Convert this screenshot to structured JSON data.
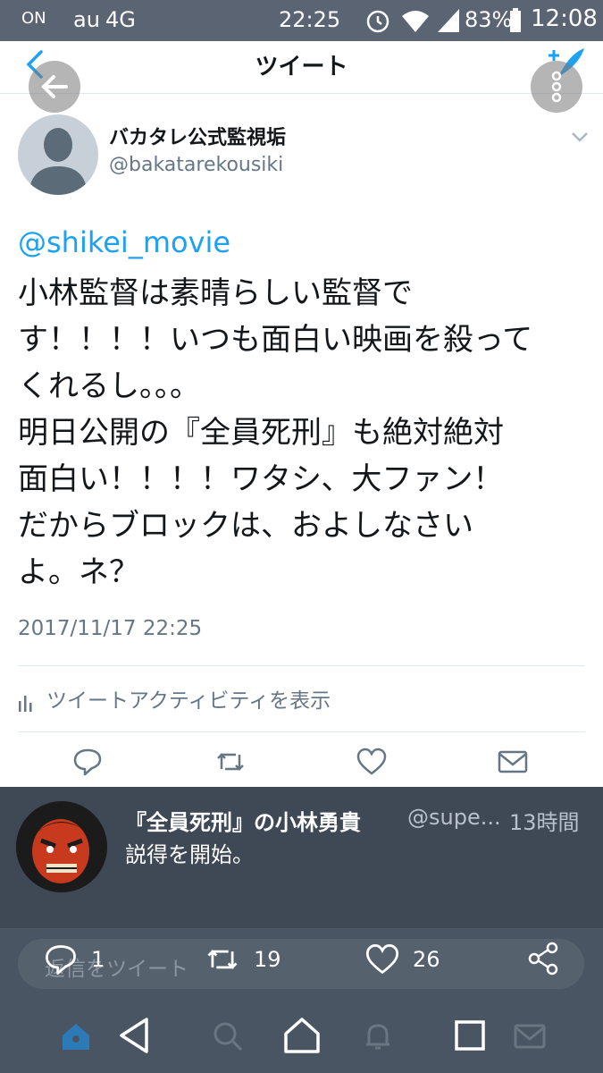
{
  "status_bar": {
    "carrier": "au",
    "network": "4G",
    "time_left": "22:25",
    "battery": "83%",
    "time_right": "12:08",
    "nfc": "ON"
  },
  "header": {
    "title": "ツイート"
  },
  "tweet": {
    "display_name": "バカタレ公式監視垢",
    "handle": "@bakatarekousiki",
    "mention": "@shikei_movie",
    "lines": [
      "小林監督は素晴らしい監督で",
      "す！！！！いつも面白い映画を殺って",
      "くれるし。。。",
      "明日公開の『全員死刑』も絶対絶対",
      "面白い！！！！ワタシ、大ファン！",
      "だからブロックは、およしなさい",
      "よ。ネ？"
    ],
    "timestamp": "2017/11/17 22:25",
    "activity_label": "ツイートアクティビティを表示"
  },
  "notification": {
    "name": "『全員死刑』の小林勇貴",
    "handle": "@supe...",
    "time": "13時間",
    "text": "説得を開始。"
  },
  "reply": {
    "placeholder": "返信をツイート",
    "reply_count": "1",
    "retweet_count": "19",
    "like_count": "26"
  },
  "colors": {
    "accent": "#1da1f2",
    "notification_bg": "#3e4955",
    "status_bar_bg": "#5a6472"
  },
  "icons": [
    "back-chevron-icon",
    "compose-icon",
    "overlay-back-icon",
    "overlay-menu-icon",
    "reply-icon",
    "retweet-icon",
    "like-icon",
    "dm-icon",
    "share-icon",
    "home-icon",
    "search-icon",
    "notifications-icon",
    "messages-icon",
    "android-back-icon",
    "android-home-icon",
    "android-recents-icon"
  ]
}
